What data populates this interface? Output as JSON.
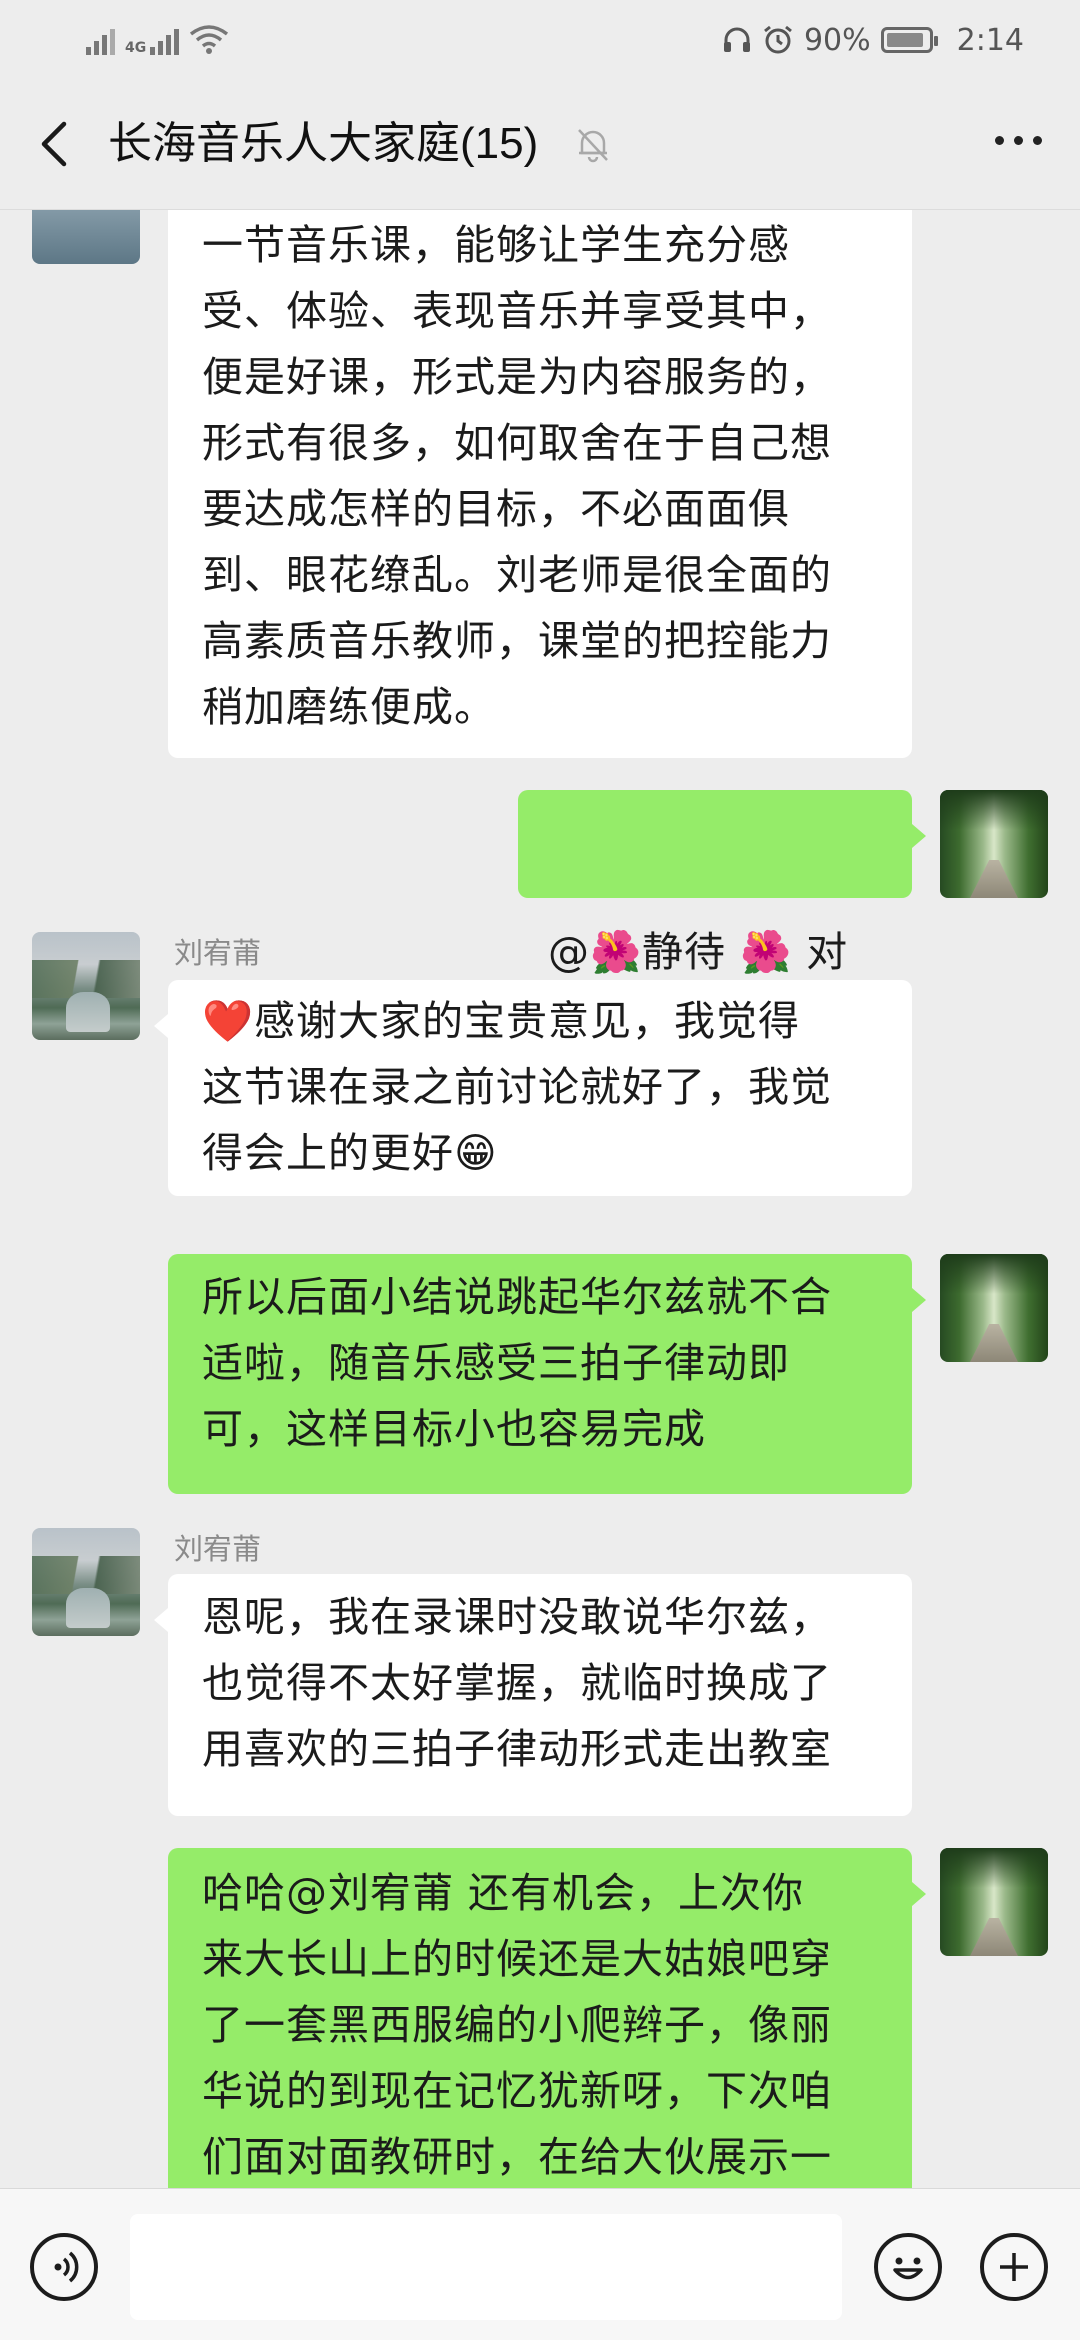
{
  "status_bar": {
    "network_label": "4G",
    "battery_percent": "90%",
    "battery_level": 0.9,
    "time": "2:14",
    "icons": [
      "no-sim-signal-icon",
      "signal-4g-icon",
      "wifi-icon",
      "headphones-icon",
      "alarm-icon",
      "battery-icon"
    ]
  },
  "header": {
    "title": "长海音乐人大家庭(15)",
    "icons": [
      "back-chevron-icon",
      "mute-bell-icon",
      "more-dots-icon"
    ]
  },
  "messages": [
    {
      "side": "left",
      "text": "一节音乐课，能够让学生充分感\n受、体验、表现音乐并享受其中，\n便是好课，形式是为内容服务的，\n形式有很多，如何取舍在于自己想\n要达成怎样的目标，不必面面俱\n到、眼花缭乱。刘老师是很全面的\n高素质音乐教师，课堂的把控能力\n稍加磨练便成。"
    },
    {
      "side": "right",
      "text": "@🌺静待 🌺  对"
    },
    {
      "side": "left",
      "sender": "刘宥莆",
      "text": "❤️感谢大家的宝贵意见，我觉得\n这节课在录之前讨论就好了，我觉\n得会上的更好😁"
    },
    {
      "side": "right",
      "text": "所以后面小结说跳起华尔兹就不合\n适啦，随音乐感受三拍子律动即\n可，这样目标小也容易完成"
    },
    {
      "side": "left",
      "sender": "刘宥莆",
      "text": "恩呢，我在录课时没敢说华尔兹，\n也觉得不太好掌握，就临时换成了\n用喜欢的三拍子律动形式走出教室"
    },
    {
      "side": "right",
      "text": "哈哈@刘宥莆  还有机会，上次你\n来大长山上的时候还是大姑娘吧穿\n了一套黑西服编的小爬辫子，像丽\n华说的到现在记忆犹新呀，下次咱\n们面对面教研时，在给大伙展示一"
    }
  ],
  "input_bar": {
    "input_value": "",
    "icons": [
      "voice-icon",
      "emoji-icon",
      "plus-icon"
    ]
  }
}
